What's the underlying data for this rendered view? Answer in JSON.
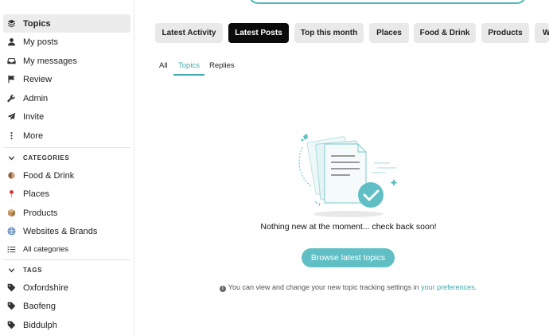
{
  "sidebar": {
    "items": [
      {
        "label": "Topics",
        "icon": "layers-icon"
      },
      {
        "label": "My posts",
        "icon": "user-icon"
      },
      {
        "label": "My messages",
        "icon": "inbox-icon"
      },
      {
        "label": "Review",
        "icon": "flag-icon"
      },
      {
        "label": "Admin",
        "icon": "wrench-icon"
      },
      {
        "label": "Invite",
        "icon": "paper-plane-icon"
      },
      {
        "label": "More",
        "icon": "ellipsis-vertical-icon"
      }
    ],
    "categories_heading": "CATEGORIES",
    "categories": [
      {
        "label": "Food & Drink",
        "icon": "coconut-icon"
      },
      {
        "label": "Places",
        "icon": "round-pushpin-icon"
      },
      {
        "label": "Products",
        "icon": "package-icon"
      },
      {
        "label": "Websites & Brands",
        "icon": "globe-icon"
      },
      {
        "label": "All categories",
        "icon": "list-icon"
      }
    ],
    "tags_heading": "TAGS",
    "tags": [
      {
        "label": "Oxfordshire",
        "icon": "tag-icon"
      },
      {
        "label": "Baofeng",
        "icon": "tag-icon"
      },
      {
        "label": "Biddulph",
        "icon": "tag-icon"
      }
    ]
  },
  "tabs": [
    {
      "label": "Latest Activity",
      "active": false
    },
    {
      "label": "Latest Posts",
      "active": true
    },
    {
      "label": "Top this month",
      "active": false
    },
    {
      "label": "Places",
      "active": false
    },
    {
      "label": "Food & Drink",
      "active": false
    },
    {
      "label": "Products",
      "active": false
    },
    {
      "label": "W",
      "active": false
    }
  ],
  "subtabs": [
    {
      "label": "All",
      "active": false
    },
    {
      "label": "Topics",
      "active": true
    },
    {
      "label": "Replies",
      "active": false
    }
  ],
  "empty_state": {
    "message": "Nothing new at the moment... check back soon!",
    "button": "Browse latest topics",
    "info_prefix": "You can view and change your new topic tracking settings in ",
    "info_link": "your preferences",
    "info_suffix": "."
  },
  "colors": {
    "accent": "#3fa9b2",
    "button": "#5fbfc4",
    "active_tab": "#0b0b0b"
  }
}
